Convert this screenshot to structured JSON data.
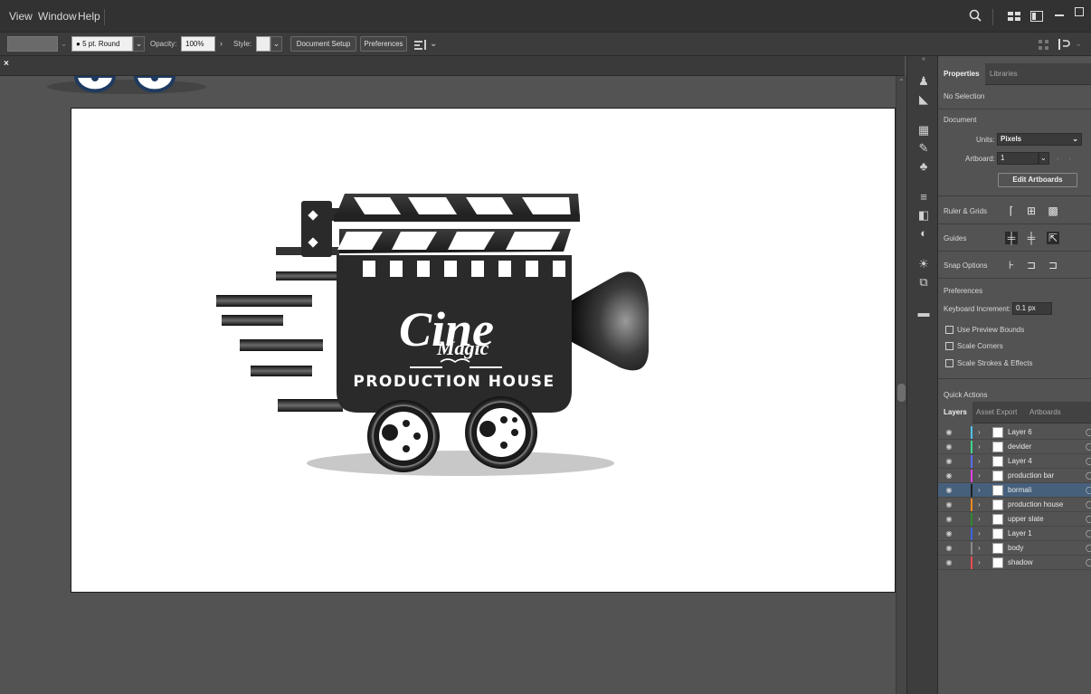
{
  "menubar": {
    "items": [
      "View",
      "Window",
      "Help"
    ]
  },
  "controlbar": {
    "stroke_profile": "5 pt. Round",
    "opacity_label": "Opacity:",
    "opacity_value": "100%",
    "style_label": "Style:",
    "document_setup": "Document Setup",
    "preferences": "Preferences"
  },
  "artwork": {
    "brand_name": "Cine",
    "brand_script": "Magic",
    "brand_tagline": "PRODUCTION HOUSE"
  },
  "properties_panel": {
    "tabs": [
      "Properties",
      "Libraries"
    ],
    "selection": "No Selection",
    "document_header": "Document",
    "units_label": "Units:",
    "units_value": "Pixels",
    "artboard_label": "Artboard:",
    "artboard_value": "1",
    "edit_artboards": "Edit Artboards",
    "ruler_grids": "Ruler & Grids",
    "guides": "Guides",
    "snap_options": "Snap Options",
    "preferences_header": "Preferences",
    "keyboard_increment_label": "Keyboard Increment:",
    "keyboard_increment_value": "0.1 px",
    "checkboxes": [
      "Use Preview Bounds",
      "Scale Corners",
      "Scale Strokes & Effects"
    ],
    "quick_actions": "Quick Actions"
  },
  "layers_panel": {
    "tabs": [
      "Layers",
      "Asset Export",
      "Artboards"
    ],
    "layers": [
      {
        "name": "Layer 6",
        "color": "#4fc3e8"
      },
      {
        "name": "devider",
        "color": "#3dd68c"
      },
      {
        "name": "Layer 4",
        "color": "#5b6cff"
      },
      {
        "name": "production bar",
        "color": "#e040e0"
      },
      {
        "name": "bormali",
        "color": "#222222"
      },
      {
        "name": "production house",
        "color": "#f08a1c"
      },
      {
        "name": "upper slate",
        "color": "#2f8a2f"
      },
      {
        "name": "Layer 1",
        "color": "#3c66e0"
      },
      {
        "name": "body",
        "color": "#8a8a8a"
      },
      {
        "name": "shadow",
        "color": "#e84c4c"
      }
    ],
    "selected_index": 4
  }
}
